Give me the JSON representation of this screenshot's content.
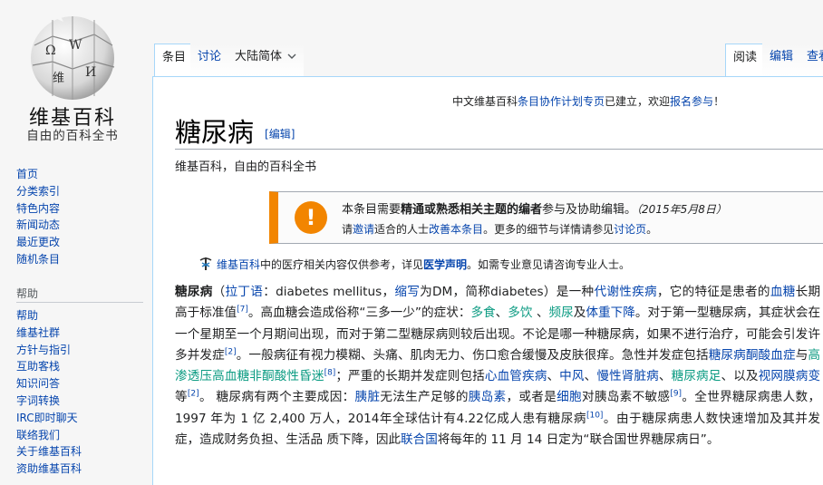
{
  "sidebar": {
    "logo_title": "维基百科",
    "logo_subtitle": "自由的百科全书",
    "globe_glyphs": [
      "Ω",
      "W",
      "维",
      "И"
    ],
    "nav": [
      "首页",
      "分类索引",
      "特色内容",
      "新闻动态",
      "最近更改",
      "随机条目"
    ],
    "help_heading": "帮助",
    "help": [
      "帮助",
      "维基社群",
      "方针与指引",
      "互助客栈",
      "知识问答",
      "字词转换",
      "IRC即时聊天",
      "联络我们",
      "关于维基百科",
      "资助维基百科"
    ]
  },
  "tabs": {
    "article": "条目",
    "talk": "讨论",
    "variant": "大陆简体",
    "read": "阅读",
    "edit": "编辑",
    "history": "查看"
  },
  "notice": {
    "pre": "中文维基百科",
    "link1": "条目协作计划专页",
    "mid": "已建立，欢迎",
    "link2": "报名参与",
    "post": "！"
  },
  "title": "糖尿病",
  "title_edit": "[编辑]",
  "tagline": "维基百科，自由的百科全书",
  "ambox": {
    "icon": "!",
    "l1_a": "本条目需要",
    "l1_b": "精通或熟悉相关主题的编者",
    "l1_c": "参与及协助编辑。",
    "l1_date": "（2015年5月8日）",
    "l2_a": "请",
    "l2_link1": "邀请",
    "l2_b": "适合的人士",
    "l2_link2": "改善本条目",
    "l2_c": "。更多的细节与详情请参见",
    "l2_link3": "讨论页",
    "l2_d": "。"
  },
  "medical": {
    "link1": "维基百科",
    "a": "中的医疗相关内容仅供参考，详见",
    "link2": "医学声明",
    "b": "。如需专业意见请咨询专业人士。"
  },
  "body": {
    "t1": "糖尿病",
    "t2": "（",
    "t3": "拉丁语",
    "t4": "：diabetes mellitus，",
    "t5": "缩写",
    "t6": "为DM，简称diabetes）是一种",
    "t7": "代谢性疾病",
    "t8": "，它的特征是患者的",
    "t9": "血糖",
    "t10": "长期高于标准值",
    "t11": "[7]",
    "t12": "。高血糖会造成俗称“三多一少”的症状：",
    "t13": "多食",
    "t14": "、",
    "t15": "多饮",
    "t16": " 、",
    "t17": "频尿",
    "t18": "及",
    "t19": "体重下降",
    "t20": "。对于第一型糖尿病，其症状会在一个星期至一个月期间出现，而对于第二型糖尿病则较后出现。不论是哪一种糖尿病，如果不进行治疗，可能会引发许多并发症",
    "t21": "[2]",
    "t22": "。一般病征有视力模糊、头痛、肌肉无力、伤口愈合缓慢及皮肤很痒。急性并发症包括",
    "t23": "糖尿病酮酸血症",
    "t24": "与",
    "t25": "高渗透压高血糖非酮酸性昏迷",
    "t26": "[8]",
    "t27": "；严重的长期并发症则包括",
    "t28": "心血管疾病",
    "t29": "、",
    "t30": "中风",
    "t31": "、",
    "t32": "慢性肾脏病",
    "t33": "、",
    "t34": "糖尿病足",
    "t35": "、以及",
    "t36": "视网膜病变",
    "t37": "等",
    "t38": "[2]",
    "t39": "。 糖尿病有两个主要成因：",
    "t40": "胰脏",
    "t41": "无法生产足够的",
    "t42": "胰岛素",
    "t43": "，或者是",
    "t44": "细胞",
    "t45": "对胰岛素不敏感",
    "t46": "[9]",
    "t47": "。全世界糖尿病患人数，1997 年为 1 亿 2,400 万人，2014年全球估计有4.22亿成人患有糖尿病",
    "t48": "[10]",
    "t49": "。由于糖尿病患人数快速增加及其并发症，造成财务负担、生活品 质下降，因此",
    "t50": "联合国",
    "t51": "将每年的 11 月 14 日定为“联合国世界糖尿病日”。"
  },
  "colors": {
    "link": "#0645ad",
    "teal": "#0b9b82",
    "ambox_accent": "#f28500"
  }
}
